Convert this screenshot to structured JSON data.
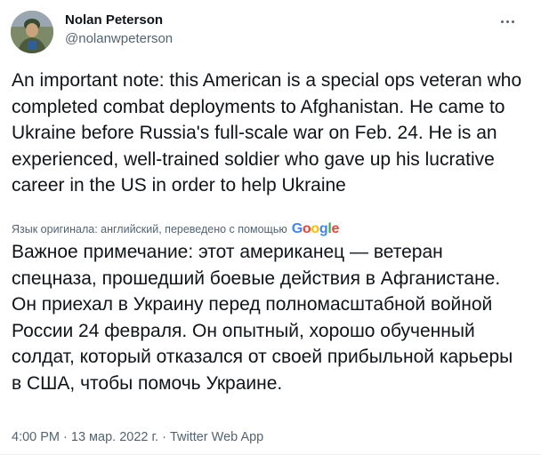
{
  "author": {
    "name": "Nolan Peterson",
    "handle": "@nolanwpeterson"
  },
  "tweet": {
    "text": "An important note: this American is a special ops veteran who completed combat deployments to Afghanistan. He came to Ukraine before Russia's full-scale war on Feb. 24. He is an experienced, well-trained soldier who gave up his lucrative career in the US in order to help Ukraine",
    "translation_note": "Язык оригинала: английский, переведено с помощью",
    "translation_provider": "Google",
    "translated_text": "Важное примечание: этот американец — ветеран спецназа, прошедший боевые действия в Афганистане. Он приехал в Украину перед полномасштабной войной России 24 февраля. Он опытный, хорошо обученный солдат, который отказался от своей прибыльной карьеры в США, чтобы помочь Украине."
  },
  "meta": {
    "time": "4:00 PM",
    "separator1": " · ",
    "date": "13 мар. 2022 г.",
    "separator2": " · ",
    "source": "Twitter Web App"
  },
  "colors": {
    "text": "#0f1419",
    "secondary": "#536471",
    "google_blue": "#4285F4",
    "google_red": "#EA4335",
    "google_yellow": "#FBBC05",
    "google_green": "#34A853"
  },
  "icons": {
    "more": "more-horizontal-icon",
    "avatar": "profile-photo"
  }
}
